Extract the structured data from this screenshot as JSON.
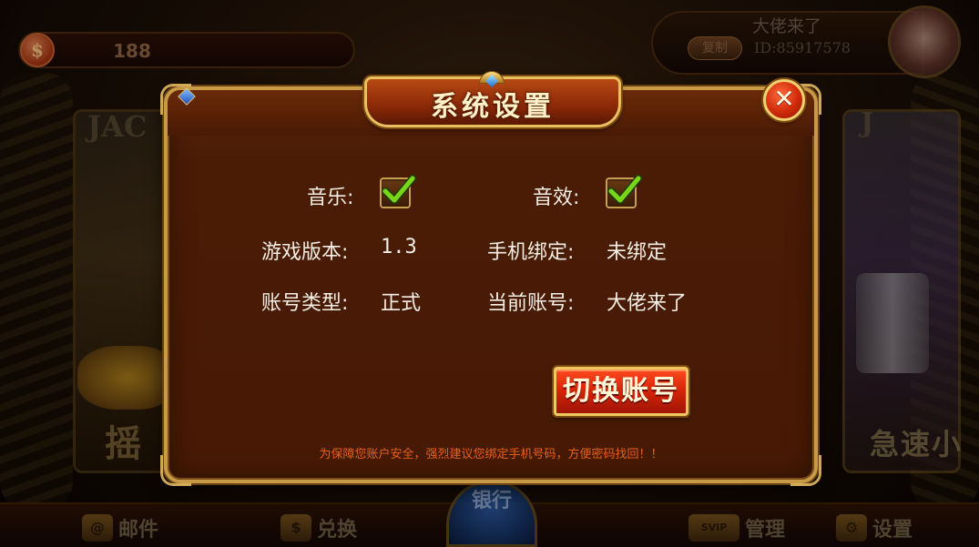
{
  "top_bar": {
    "coin_symbol": "$",
    "coin_amount": "188",
    "user_name": "大佬来了",
    "copy_label": "复制",
    "user_id": "ID:85917578"
  },
  "bottom_bar": {
    "mail_label": "邮件",
    "exchange_label": "兑换",
    "bank_label": "银行",
    "manage_label": "管理",
    "settings_label": "设置",
    "vip_badge": "SVIP"
  },
  "background": {
    "left_game_text": "JAC",
    "left_game_label": "摇",
    "right_game_text": "J",
    "right_game_label": "急速小"
  },
  "dialog": {
    "title": "系统设置",
    "close_symbol": "✕",
    "music_label": "音乐:",
    "music_checked": true,
    "sound_label": "音效:",
    "sound_checked": true,
    "version_label": "游戏版本:",
    "version_value": "1.3",
    "phone_label": "手机绑定:",
    "phone_value": "未绑定",
    "account_type_label": "账号类型:",
    "account_type_value": "正式",
    "current_account_label": "当前账号:",
    "current_account_value": "大佬来了",
    "switch_button_label": "切换账号",
    "notice": "为保障您账户安全，强烈建议您绑定手机号码，方便密码找回！！"
  },
  "colors": {
    "dialog_bg": "#4a1c06",
    "dialog_border": "#c79a48",
    "button_red": "#d8260a",
    "notice_orange": "#e8601a",
    "check_green": "#7ad61a"
  }
}
